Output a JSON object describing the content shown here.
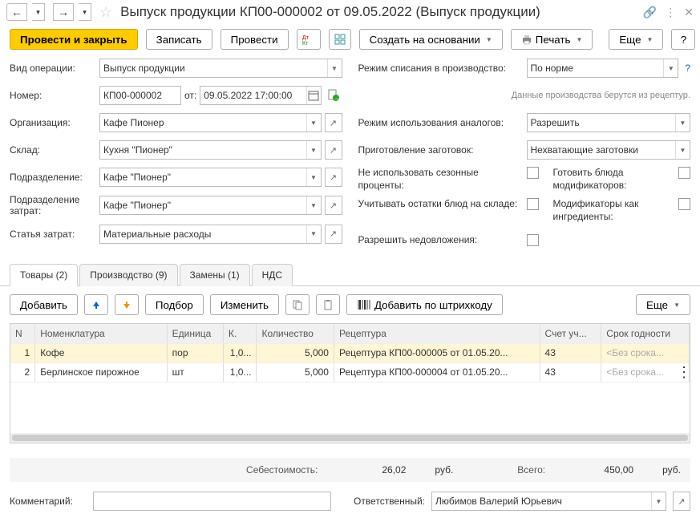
{
  "title": "Выпуск продукции КП00-000002 от 09.05.2022 (Выпуск продукции)",
  "toolbar": {
    "post_close": "Провести и закрыть",
    "write": "Записать",
    "post": "Провести",
    "create_based": "Создать на основании",
    "print": "Печать",
    "more": "Еще",
    "help": "?"
  },
  "left": {
    "op_type_label": "Вид операции:",
    "op_type": "Выпуск продукции",
    "number_label": "Номер:",
    "number": "КП00-000002",
    "from_label": "от:",
    "date": "09.05.2022 17:00:00",
    "org_label": "Организация:",
    "org": "Кафе Пионер",
    "wh_label": "Склад:",
    "wh": "Кухня \"Пионер\"",
    "dept_label": "Подразделение:",
    "dept": "Кафе \"Пионер\"",
    "costdept_label": "Подразделение затрат:",
    "costdept": "Кафе \"Пионер\"",
    "article_label": "Статья затрат:",
    "article": "Материальные расходы"
  },
  "right": {
    "writeoff_mode_label": "Режим списания в производство:",
    "writeoff_mode": "По норме",
    "note": "Данные производства берутся из рецептур.",
    "analogs_label": "Режим использования аналогов:",
    "analogs": "Разрешить",
    "preps_label": "Приготовление заготовок:",
    "preps": "Нехватающие заготовки",
    "seasonal_label": "Не использовать сезонные проценты:",
    "cookmods_label": "Готовить блюда модификаторов:",
    "stock_label": "Учитывать остатки блюд на складе:",
    "modsing_label": "Модификаторы как ингредиенты:",
    "allowshort_label": "Разрешить недовложения:"
  },
  "tabs": {
    "goods": "Товары (2)",
    "prod": "Производство (9)",
    "subs": "Замены (1)",
    "vat": "НДС"
  },
  "tabbar": {
    "add": "Добавить",
    "pick": "Подбор",
    "edit": "Изменить",
    "barcode": "Добавить по штрихкоду",
    "more": "Еще"
  },
  "table": {
    "cols": {
      "n": "N",
      "nom": "Номенклатура",
      "unit": "Единица",
      "k": "К.",
      "qty": "Количество",
      "recipe": "Рецептура",
      "acc": "Счет уч...",
      "exp": "Срок годности"
    },
    "rows": [
      {
        "n": "1",
        "nom": "Кофе",
        "unit": "пор",
        "k": "1,0...",
        "qty": "5,000",
        "recipe": "Рецептура КП00-000005 от 01.05.20...",
        "acc": "43",
        "exp": "<Без срока...",
        "selected": true
      },
      {
        "n": "2",
        "nom": "Берлинское пирожное",
        "unit": "шт",
        "k": "1,0...",
        "qty": "5,000",
        "recipe": "Рецептура КП00-000004 от 01.05.20...",
        "acc": "43",
        "exp": "<Без срока...",
        "selected": false
      }
    ]
  },
  "totals": {
    "cost_label": "Себестоимость:",
    "cost": "26,02",
    "total_label": "Всего:",
    "total": "450,00",
    "cur": "руб."
  },
  "footer": {
    "comment_label": "Комментарий:",
    "resp_label": "Ответственный:",
    "resp": "Любимов Валерий Юрьевич"
  }
}
